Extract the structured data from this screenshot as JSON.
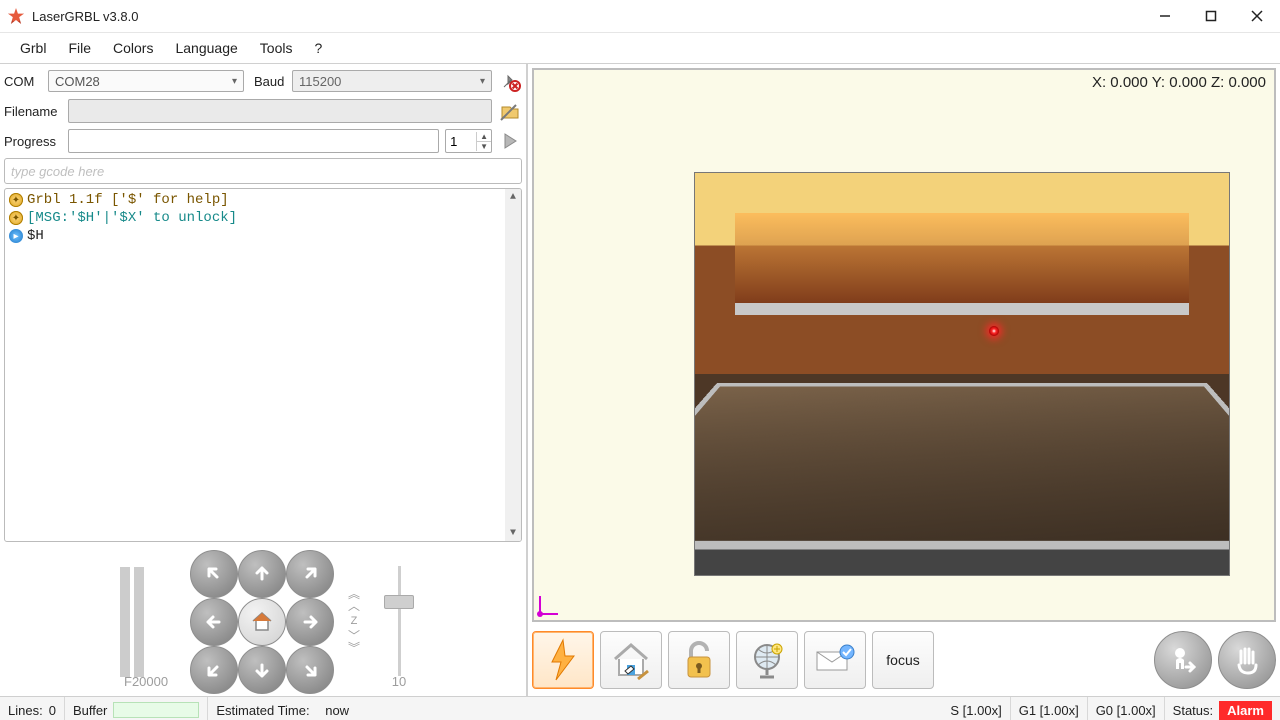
{
  "window": {
    "title": "LaserGRBL v3.8.0"
  },
  "menu": {
    "items": [
      "Grbl",
      "File",
      "Colors",
      "Language",
      "Tools",
      "?"
    ]
  },
  "connection": {
    "com_label": "COM",
    "com_port": "COM28",
    "baud_label": "Baud",
    "baud_rate": "115200"
  },
  "filename": {
    "label": "Filename",
    "value": ""
  },
  "progress": {
    "label": "Progress",
    "passes": "1"
  },
  "gcode_input": {
    "placeholder": "type gcode here"
  },
  "console": {
    "lines": [
      {
        "icon": "sys",
        "class": "gold",
        "text": "Grbl 1.1f ['$' for help]"
      },
      {
        "icon": "sys",
        "class": "teal",
        "text": "[MSG:'$H'|'$X' to unlock]"
      },
      {
        "icon": "run",
        "class": "black",
        "text": "$H"
      }
    ]
  },
  "jog": {
    "feed": "F20000",
    "z_label": "Z",
    "step_value": "10"
  },
  "coords": {
    "text": "X: 0.000 Y: 0.000 Z: 0.000"
  },
  "macros": {
    "focus_label": "focus"
  },
  "statusbar": {
    "lines_label": "Lines:",
    "lines_value": "0",
    "buffer_label": "Buffer",
    "estimated_label": "Estimated Time:",
    "estimated_value": "now",
    "s_cell": "S [1.00x]",
    "g1_cell": "G1 [1.00x]",
    "g0_cell": "G0 [1.00x]",
    "status_label": "Status:",
    "status_value": "Alarm"
  }
}
